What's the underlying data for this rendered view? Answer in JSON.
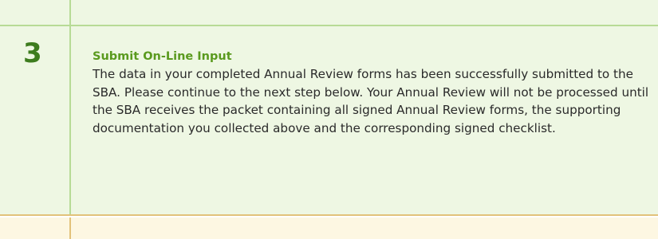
{
  "step": {
    "number": "3",
    "title": "Submit On-Line Input",
    "body": "The data in your completed Annual Review forms has been successfully submitted to the SBA. Please continue to the next step below. Your Annual Review will not be processed until the SBA receives the packet containing all signed Annual Review forms, the supporting documentation you collected above and the corresponding signed checklist."
  },
  "colors": {
    "step_number": "#3d7c1e",
    "title": "#5a9a1e",
    "row_background_green": "#eef7e3",
    "row_border_green": "#b7db96",
    "row_background_yellow": "#fdf7e2",
    "row_border_yellow": "#e2c27a"
  }
}
